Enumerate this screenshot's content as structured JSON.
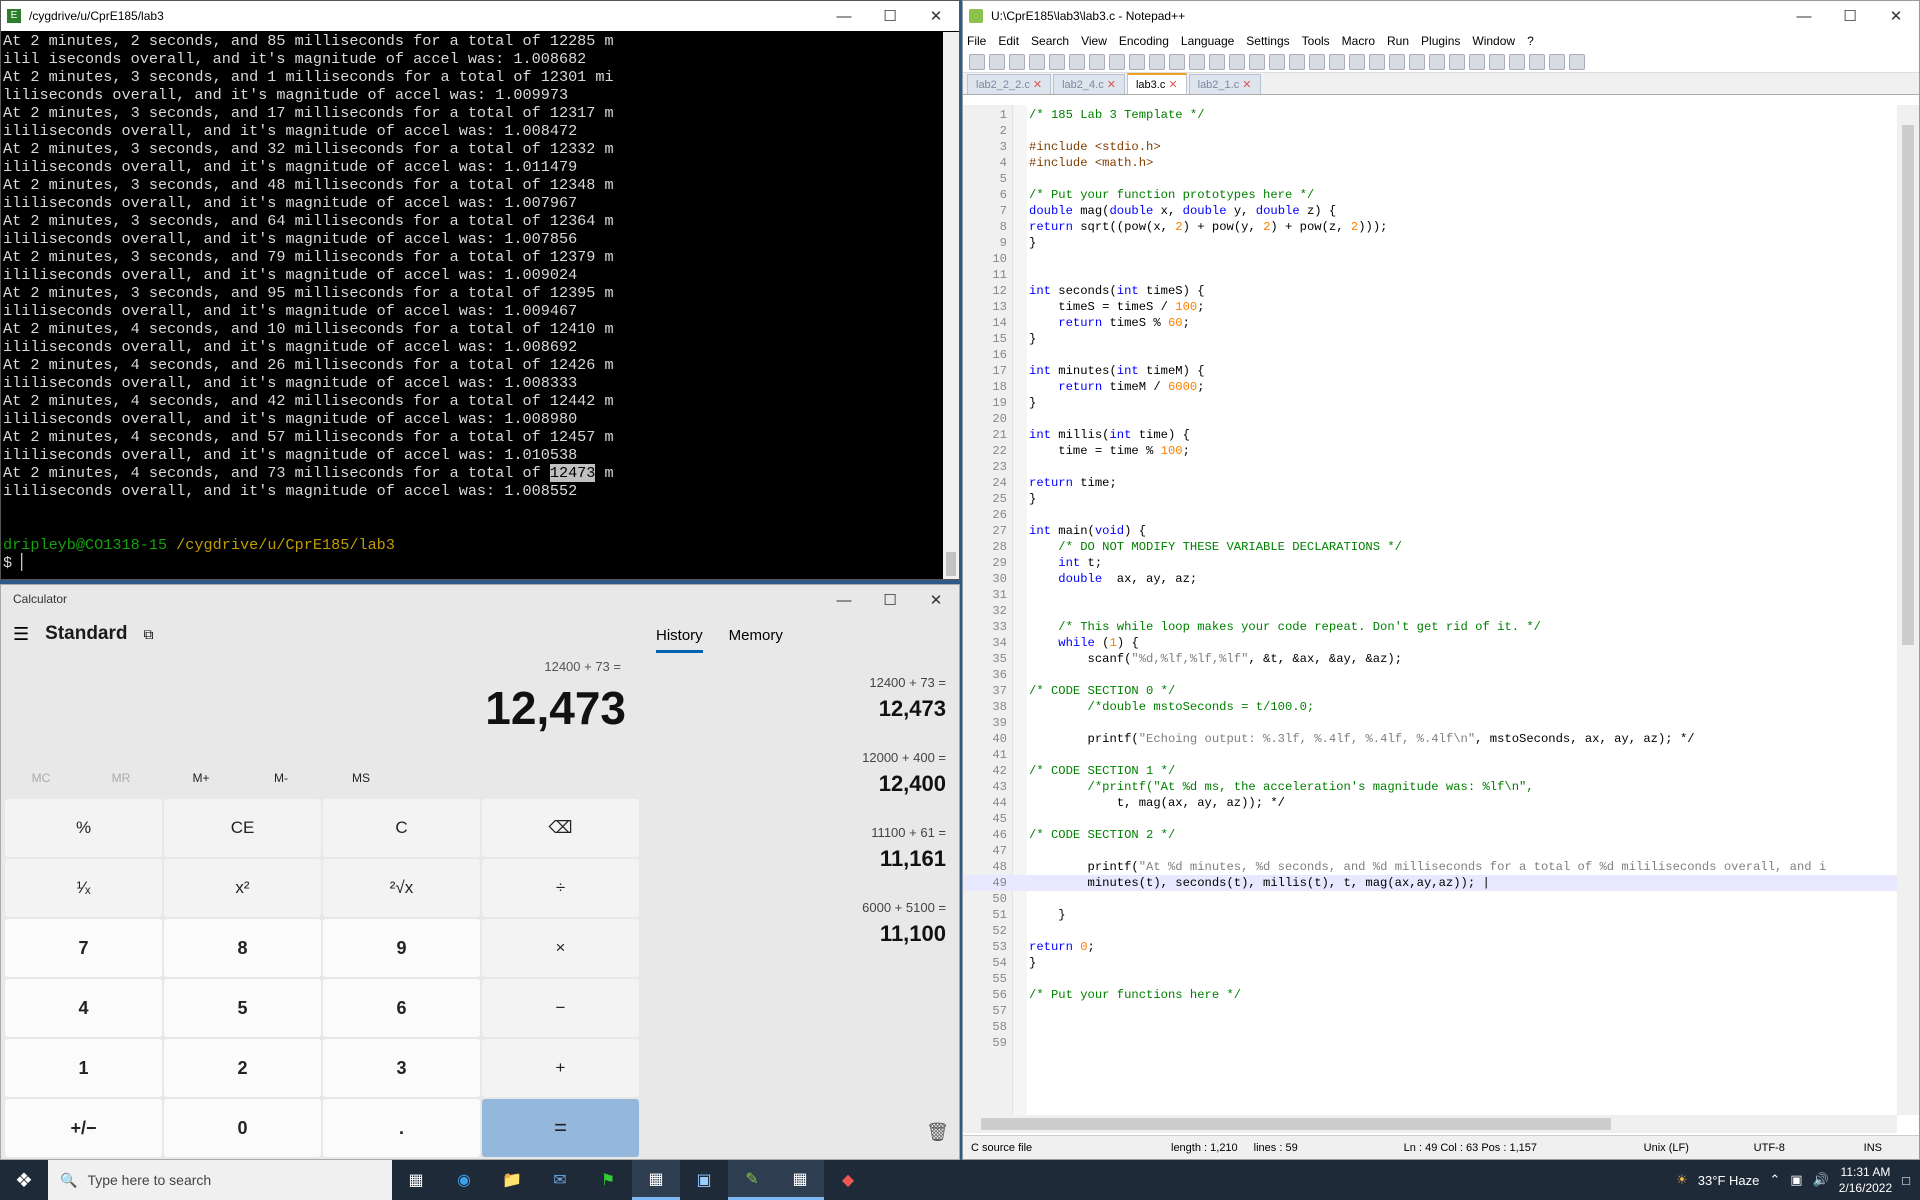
{
  "terminal": {
    "title": "/cygdrive/u/CprE185/lab3",
    "lines": [
      "At 2 minutes, 2 seconds, and 85 milliseconds for a total of 12285 m",
      "ilil iseconds overall, and it's magnitude of accel was: 1.008682",
      "At 2 minutes, 3 seconds, and 1 milliseconds for a total of 12301 mi",
      "liliseconds overall, and it's magnitude of accel was: 1.009973",
      "At 2 minutes, 3 seconds, and 17 milliseconds for a total of 12317 m",
      "ililiseconds overall, and it's magnitude of accel was: 1.008472",
      "At 2 minutes, 3 seconds, and 32 milliseconds for a total of 12332 m",
      "ililiseconds overall, and it's magnitude of accel was: 1.011479",
      "At 2 minutes, 3 seconds, and 48 milliseconds for a total of 12348 m",
      "ililiseconds overall, and it's magnitude of accel was: 1.007967",
      "At 2 minutes, 3 seconds, and 64 milliseconds for a total of 12364 m",
      "ililiseconds overall, and it's magnitude of accel was: 1.007856",
      "At 2 minutes, 3 seconds, and 79 milliseconds for a total of 12379 m",
      "ililiseconds overall, and it's magnitude of accel was: 1.009024",
      "At 2 minutes, 3 seconds, and 95 milliseconds for a total of 12395 m",
      "ililiseconds overall, and it's magnitude of accel was: 1.009467",
      "At 2 minutes, 4 seconds, and 10 milliseconds for a total of 12410 m",
      "ililiseconds overall, and it's magnitude of accel was: 1.008692",
      "At 2 minutes, 4 seconds, and 26 milliseconds for a total of 12426 m",
      "ililiseconds overall, and it's magnitude of accel was: 1.008333",
      "At 2 minutes, 4 seconds, and 42 milliseconds for a total of 12442 m",
      "ililiseconds overall, and it's magnitude of accel was: 1.008980",
      "At 2 minutes, 4 seconds, and 57 milliseconds for a total of 12457 m",
      "ililiseconds overall, and it's magnitude of accel was: 1.010538"
    ],
    "last_prefix": "At 2 minutes, 4 seconds, and 73 milliseconds for a total of ",
    "last_highlight": "12473",
    "last_suffix": " m",
    "last_line2": "ililiseconds overall, and it's magnitude of accel was: 1.008552",
    "prompt_user": "dripleyb@CO1318-15",
    "prompt_path": " /cygdrive/u/CprE185/lab3",
    "prompt": "$ "
  },
  "calculator": {
    "title": "Calculator",
    "mode": "Standard",
    "expression": "12400 + 73 =",
    "display": "12,473",
    "memory_buttons": [
      "MC",
      "MR",
      "M+",
      "M-",
      "MS"
    ],
    "keys": [
      "%",
      "CE",
      "C",
      "⌫",
      "¹⁄ₓ",
      "x²",
      "²√x",
      "÷",
      "7",
      "8",
      "9",
      "×",
      "4",
      "5",
      "6",
      "−",
      "1",
      "2",
      "3",
      "+",
      "+/−",
      "0",
      ".",
      "="
    ],
    "tab_history": "History",
    "tab_memory": "Memory",
    "history": [
      {
        "expr": "12400   +   73 =",
        "result": "12,473"
      },
      {
        "expr": "12000   +   400 =",
        "result": "12,400"
      },
      {
        "expr": "11100   +   61 =",
        "result": "11,161"
      },
      {
        "expr": "6000   +   5100 =",
        "result": "11,100"
      }
    ]
  },
  "notepad": {
    "title": "U:\\CprE185\\lab3\\lab3.c - Notepad++",
    "menu": [
      "File",
      "Edit",
      "Search",
      "View",
      "Encoding",
      "Language",
      "Settings",
      "Tools",
      "Macro",
      "Run",
      "Plugins",
      "Window",
      "?"
    ],
    "tabs": [
      "lab2_2_2.c",
      "lab2_4.c",
      "lab3.c",
      "lab2_1.c"
    ],
    "active_tab": "lab3.c",
    "status": {
      "filetype": "C source file",
      "length": "length : 1,210",
      "lines": "lines : 59",
      "position": "Ln : 49    Col : 63    Pos : 1,157",
      "eol": "Unix (LF)",
      "encoding": "UTF-8",
      "mode": "INS"
    },
    "code": [
      "/* 185 Lab 3 Template */",
      "",
      "#include <stdio.h>",
      "#include <math.h>",
      "",
      "/* Put your function prototypes here */",
      "double mag(double x, double y, double z) {",
      "return sqrt((pow(x, 2) + pow(y, 2) + pow(z, 2)));",
      "}",
      "",
      "",
      "int seconds(int timeS) {",
      "    timeS = timeS / 100;",
      "    return timeS % 60;",
      "}",
      "",
      "int minutes(int timeM) {",
      "    return timeM / 6000;",
      "}",
      "",
      "int millis(int time) {",
      "    time = time % 100;",
      "",
      "return time;",
      "}",
      "",
      "int main(void) {",
      "    /* DO NOT MODIFY THESE VARIABLE DECLARATIONS */",
      "    int t;",
      "    double  ax, ay, az;",
      "",
      "",
      "    /* This while loop makes your code repeat. Don't get rid of it. */",
      "    while (1) {",
      "        scanf(\"%d,%lf,%lf,%lf\", &t, &ax, &ay, &az);",
      "",
      "/* CODE SECTION 0 */",
      "        /*double mstoSeconds = t/100.0;",
      "",
      "        printf(\"Echoing output: %.3lf, %.4lf, %.4lf, %.4lf\\n\", mstoSeconds, ax, ay, az); */",
      "",
      "/* CODE SECTION 1 */",
      "        /*printf(\"At %d ms, the acceleration's magnitude was: %lf\\n\",",
      "            t, mag(ax, ay, az)); */",
      "",
      "/* CODE SECTION 2 */",
      "",
      "        printf(\"At %d minutes, %d seconds, and %d milliseconds for a total of %d mililiseconds overall, and i",
      "        minutes(t), seconds(t), millis(t), t, mag(ax,ay,az)); |",
      "",
      "    }",
      "",
      "return 0;",
      "}",
      "",
      "/* Put your functions here */",
      "",
      "",
      ""
    ]
  },
  "taskbar": {
    "search_placeholder": "Type here to search",
    "weather": "33°F  Haze",
    "time": "11:31 AM",
    "date": "2/16/2022"
  }
}
